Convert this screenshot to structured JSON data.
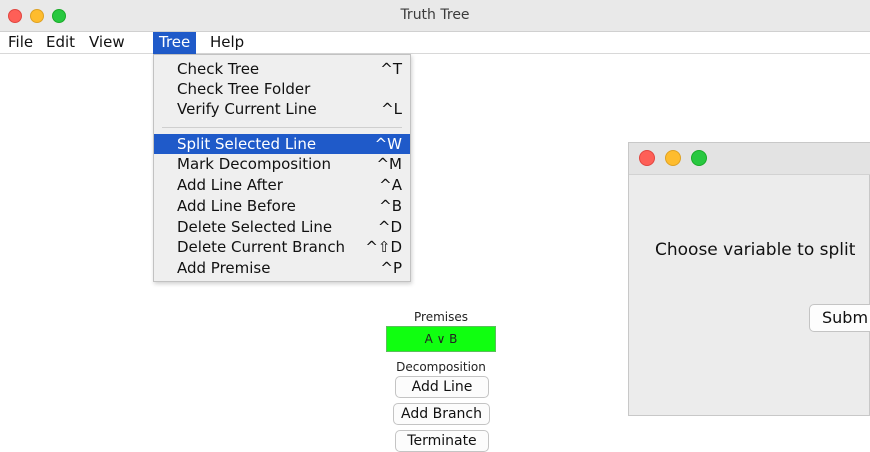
{
  "window": {
    "title": "Truth Tree"
  },
  "menubar": {
    "file": "File",
    "edit": "Edit",
    "view": "View",
    "tree": "Tree",
    "help": "Help"
  },
  "tree_menu": {
    "items": [
      {
        "label": "Check Tree",
        "shortcut": "^T"
      },
      {
        "label": "Check Tree Folder",
        "shortcut": ""
      },
      {
        "label": "Verify Current Line",
        "shortcut": "^L"
      },
      {
        "label": "Split Selected Line",
        "shortcut": "^W",
        "selected": true
      },
      {
        "label": "Mark Decomposition",
        "shortcut": "^M"
      },
      {
        "label": "Add Line After",
        "shortcut": "^A"
      },
      {
        "label": "Add Line Before",
        "shortcut": "^B"
      },
      {
        "label": "Delete Selected Line",
        "shortcut": "^D"
      },
      {
        "label": "Delete Current Branch",
        "shortcut": "^⇧D"
      },
      {
        "label": "Add Premise",
        "shortcut": "^P"
      }
    ]
  },
  "tree_panel": {
    "premises_label": "Premises",
    "premise_value": "A ∨ B",
    "premise_color": "#10ff10",
    "decomposition_label": "Decomposition",
    "add_line": "Add Line",
    "add_branch": "Add Branch",
    "terminate": "Terminate"
  },
  "dialog": {
    "prompt": "Choose variable to split",
    "submit_label": "Subm"
  },
  "colors": {
    "menu_highlight": "#1f5ac9",
    "close": "#fe5f57",
    "minimize": "#febc2e",
    "maximize": "#28c840"
  }
}
